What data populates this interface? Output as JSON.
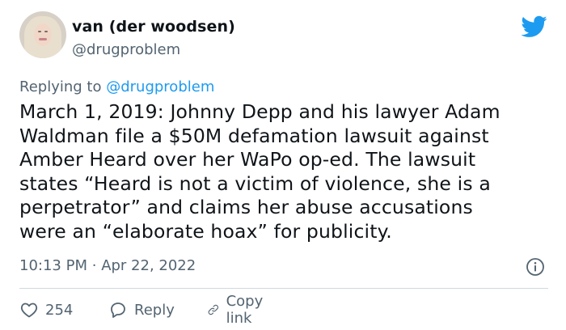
{
  "author": {
    "name": "van (der woodsen)",
    "handle": "@drugproblem",
    "avatar": "avatar-portrait",
    "logo": "twitter-bird-icon",
    "brand_color": "#1d9bf0"
  },
  "reply": {
    "prefix": "Replying to",
    "handle": "@drugproblem"
  },
  "tweet": {
    "text": "March 1, 2019: Johnny Depp and his lawyer Adam\nWaldman file a $50M defamation lawsuit against\nAmber Heard over her WaPo op-ed. The lawsuit\nstates “Heard is not a victim of violence, she is a\nperpetrator” and claims her abuse accusations\nwere an “elaborate hoax” for publicity.",
    "time": "10:13 PM",
    "separator": "·",
    "date": "Apr 22, 2022",
    "info_icon": "info-icon"
  },
  "actions": {
    "likes": "254",
    "reply_label": "Reply",
    "copy_link_label": "Copy link",
    "icons": [
      "heart-icon",
      "reply-bubble-icon",
      "link-icon"
    ]
  },
  "colors": {
    "text": "#0f1419",
    "secondary": "#536471",
    "divider": "#cfd9de"
  }
}
